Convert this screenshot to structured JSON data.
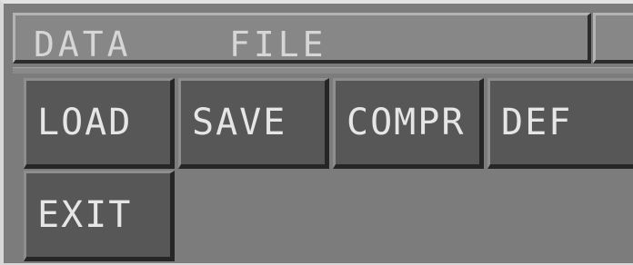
{
  "window": {
    "title": "DATA    FILE"
  },
  "buttons": {
    "load": "LOAD",
    "save": "SAVE",
    "compr": "COMPR",
    "def": "DEF",
    "exit": "EXIT"
  },
  "colors": {
    "panel_background": "#7c7c7c",
    "button_face": "#575757",
    "button_text": "#e6e6e6",
    "title_text": "#d6d6d6"
  }
}
